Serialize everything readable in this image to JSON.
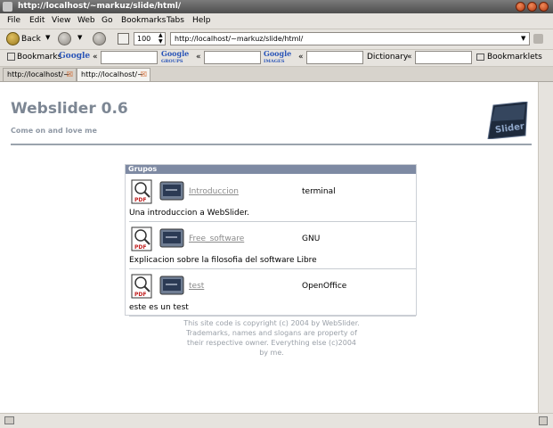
{
  "window": {
    "title": "http://localhost/~markuz/slide/html/"
  },
  "menu": [
    "File",
    "Edit",
    "View",
    "Web",
    "Go",
    "Bookmarks",
    "Tabs",
    "Help"
  ],
  "nav": {
    "back_label": "Back",
    "zoom": "100",
    "url": "http://localhost/~markuz/slide/html/"
  },
  "search_toolbar": {
    "bookmarks": "Bookmarks",
    "google": "Google",
    "google_groups_top": "Google",
    "google_groups_bottom": "GROUPS",
    "google_images_top": "Google",
    "google_images_bottom": "IMAGES",
    "arrows": "«",
    "dictionary": "Dictionary",
    "bookmarklets": "Bookmarklets"
  },
  "tabs": [
    {
      "label": "http://localhost/~"
    },
    {
      "label": "http://localhost/~"
    }
  ],
  "page": {
    "title": "Webslider 0.6",
    "subtitle": "Come on and love me",
    "logo_text": "Slider",
    "group_header": "Grupos",
    "pdf_text": "PDF",
    "items": [
      {
        "link": "Introduccion",
        "category": "terminal",
        "description": "Una introduccion a WebSlider."
      },
      {
        "link": "Free_software",
        "category": "GNU",
        "description": "Explicacion sobre la filosofia del software Libre"
      },
      {
        "link": "test",
        "category": "OpenOffice",
        "description": "este es un test"
      }
    ],
    "footer": "This site code is copyright (c) 2004 by WebSlider. Trademarks, names and slogans are property of their respective owner. Everything else (c)2004 by me."
  },
  "colors": {
    "header_bar": "#7e8aa3",
    "title": "#7d8794",
    "link": "#8a8a8a"
  }
}
